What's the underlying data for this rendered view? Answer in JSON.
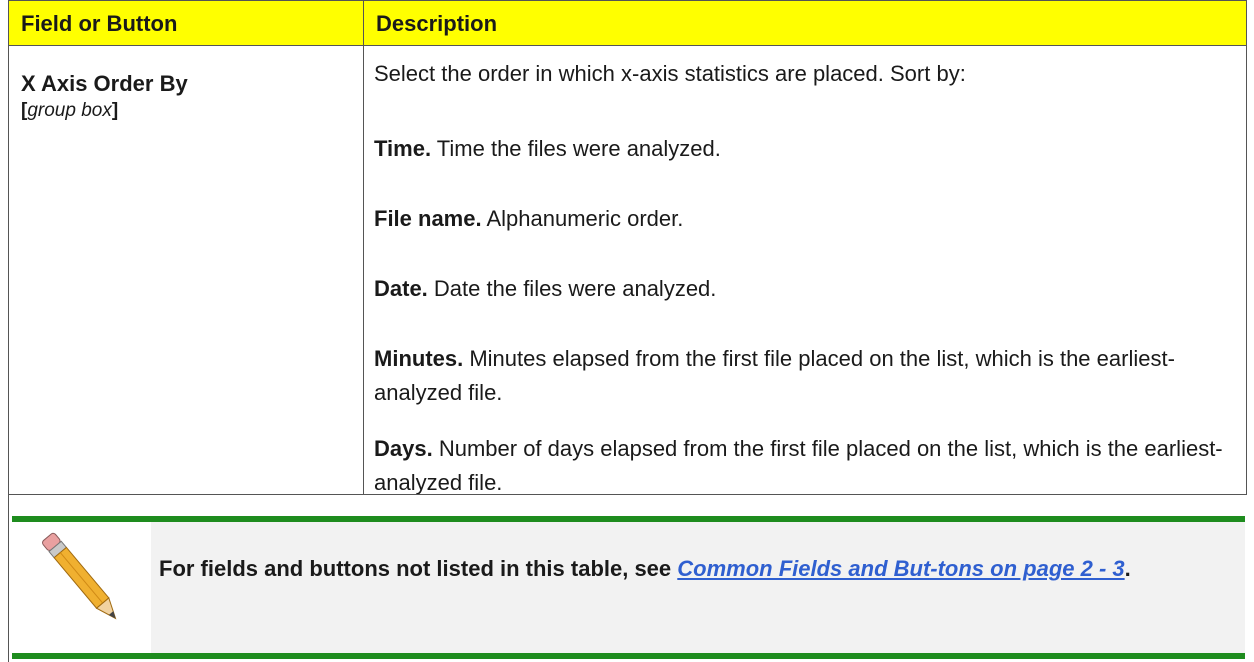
{
  "header": {
    "col1": "Field or Button",
    "col2": "Description"
  },
  "row": {
    "field_name": "X Axis Order By",
    "field_type_open": "[",
    "field_type": "group box",
    "field_type_close": "]",
    "intro": "Select the order in which x-axis statistics are placed. Sort by:",
    "options": [
      {
        "term": "Time.",
        "text": " Time the files were analyzed."
      },
      {
        "term": "File name.",
        "text": "  Alphanumeric order."
      },
      {
        "term": "Date.",
        "text": " Date the files were analyzed."
      },
      {
        "term": "Minutes.",
        "text": " Minutes elapsed from the first file placed on the list, which is the earliest-analyzed file."
      },
      {
        "term": "Days.",
        "text": " Number of days elapsed from the first file placed on the list, which is the earliest-analyzed file."
      }
    ]
  },
  "note": {
    "icon": "pencil-icon",
    "text_prefix": "For fields and buttons not listed in this table, see ",
    "link_text": "Common Fields and But-tons on page 2 - 3",
    "text_suffix": "."
  },
  "colors": {
    "header_bg": "#ffff00",
    "note_bar": "#1e8c1e",
    "note_bg": "#f2f2f2",
    "link": "#2f5fd0"
  }
}
